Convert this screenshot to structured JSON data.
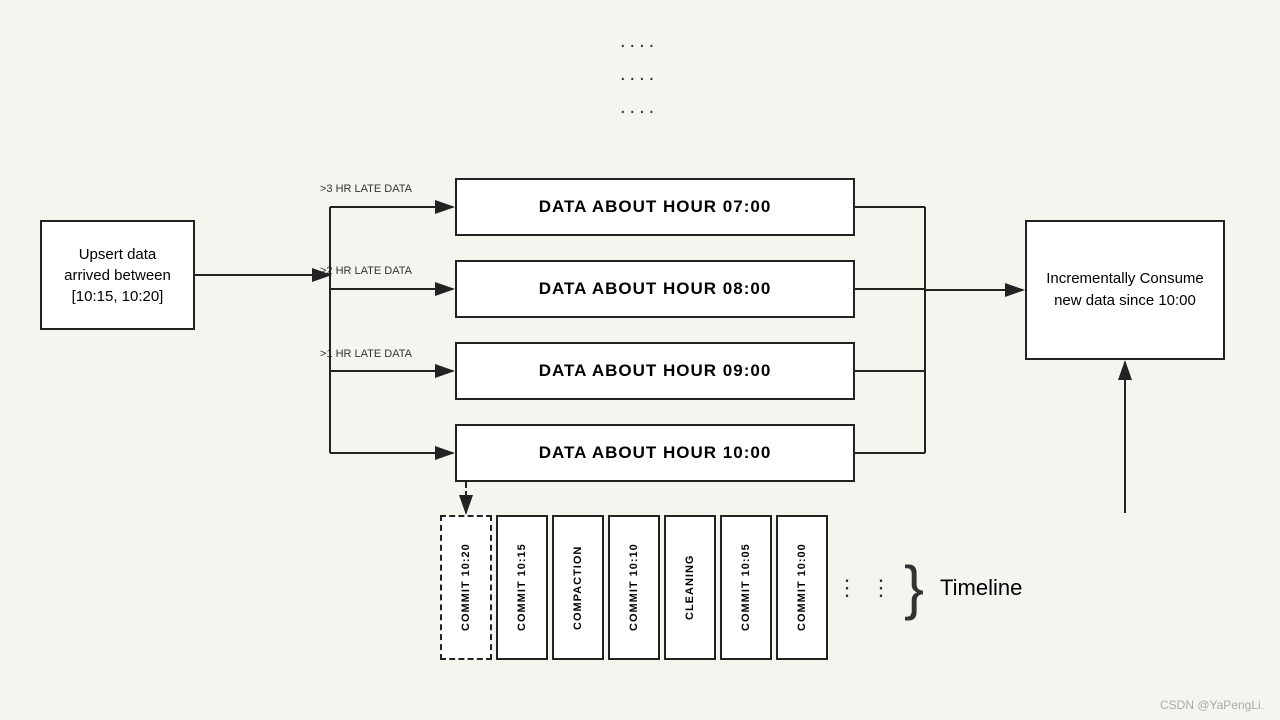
{
  "dots": [
    "....",
    "....",
    "...."
  ],
  "upsert_box": {
    "text": "Upsert data\narrived between\n[10:15, 10:20]"
  },
  "data_boxes": [
    {
      "id": "07",
      "label": "DATA ABOUT HOUR 07:00"
    },
    {
      "id": "08",
      "label": "DATA ABOUT HOUR 08:00"
    },
    {
      "id": "09",
      "label": "DATA ABOUT HOUR 09:00"
    },
    {
      "id": "10",
      "label": "DATA ABOUT HOUR 10:00"
    }
  ],
  "arrow_labels": [
    {
      "id": "late3",
      "text": ">3 HR LATE DATA"
    },
    {
      "id": "late2",
      "text": ">2 HR LATE DATA"
    },
    {
      "id": "late1",
      "text": ">1 HR LATE DATA"
    }
  ],
  "incremental_box": {
    "text": "Incrementally Consume\nnew data since 10:00"
  },
  "timeline_boxes": [
    {
      "id": "commit1020",
      "label": "COMMIT 10:20",
      "dashed": true
    },
    {
      "id": "commit1015",
      "label": "COMMIT 10:15",
      "dashed": false
    },
    {
      "id": "compaction",
      "label": "COMPACTION",
      "dashed": false
    },
    {
      "id": "commit1010",
      "label": "COMMIT 10:10",
      "dashed": false
    },
    {
      "id": "cleaning",
      "label": "CLEANING",
      "dashed": false
    },
    {
      "id": "commit1005",
      "label": "COMMIT 10:05",
      "dashed": false
    },
    {
      "id": "commit1000",
      "label": "COMMIT 10:00",
      "dashed": false
    }
  ],
  "timeline_label": "Timeline",
  "watermark": "CSDN @YaPengLi."
}
